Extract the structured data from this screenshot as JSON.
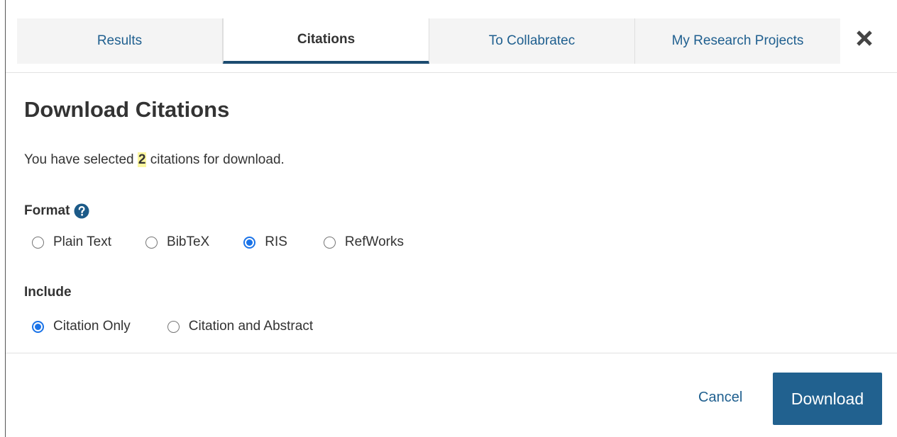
{
  "tabs": [
    {
      "label": "Results",
      "active": false
    },
    {
      "label": "Citations",
      "active": true
    },
    {
      "label": "To Collabratec",
      "active": false
    },
    {
      "label": "My Research Projects",
      "active": false
    }
  ],
  "close_icon": "close-x-icon",
  "dialog": {
    "title": "Download Citations",
    "selected_prefix": "You have selected",
    "selected_count": "2",
    "selected_suffix": "citations for download."
  },
  "format": {
    "label": "Format",
    "help_icon": "question-circle-icon",
    "options": [
      {
        "label": "Plain Text",
        "checked": false
      },
      {
        "label": "BibTeX",
        "checked": false
      },
      {
        "label": "RIS",
        "checked": true
      },
      {
        "label": "RefWorks",
        "checked": false
      }
    ]
  },
  "include": {
    "label": "Include",
    "options": [
      {
        "label": "Citation Only",
        "checked": true
      },
      {
        "label": "Citation and Abstract",
        "checked": false
      }
    ]
  },
  "actions": {
    "cancel_label": "Cancel",
    "download_label": "Download"
  },
  "colors": {
    "accent": "#21618f",
    "link": "#1f5f8f",
    "radio_checked": "#1a73e8",
    "highlight": "#fbf6a0"
  }
}
